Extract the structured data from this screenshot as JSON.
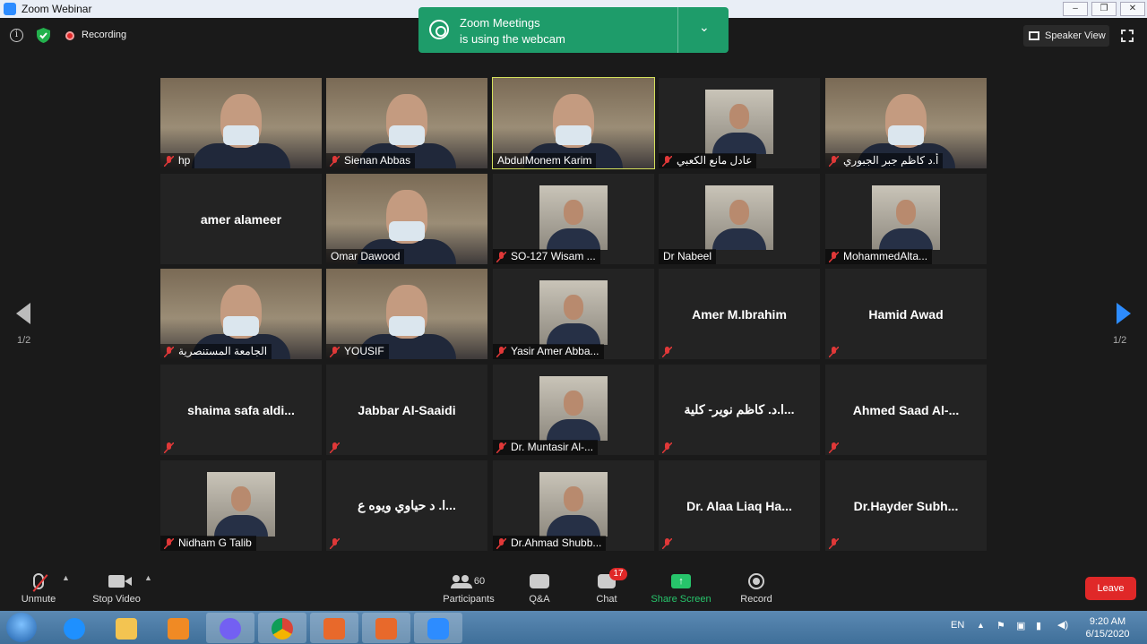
{
  "window": {
    "title": "Zoom Webinar",
    "controls": [
      "–",
      "❐",
      "✕"
    ]
  },
  "topbar": {
    "info_icon": "i",
    "recording_label": "Recording",
    "speaker_view_label": "Speaker View"
  },
  "toast": {
    "line1": "Zoom Meetings",
    "line2": "is using the webcam",
    "chevron": "⌄"
  },
  "grid": {
    "page_indicator_left": "1/2",
    "page_indicator_right": "1/2",
    "tiles": [
      {
        "name": "hp",
        "video": true,
        "muted": true
      },
      {
        "name": "Sienan Abbas",
        "video": true,
        "muted": true
      },
      {
        "name": "AbdulMonem Karim",
        "video": true,
        "muted": false,
        "active": true
      },
      {
        "name": "عادل مانع الكعبي",
        "video": true,
        "muted": true
      },
      {
        "name": "أ.د كاظم جبر الجبوري",
        "video": true,
        "muted": true
      },
      {
        "name": "amer alameer",
        "video": false,
        "muted": false
      },
      {
        "name": "Omar Dawood",
        "video": true,
        "muted": false
      },
      {
        "name": "SO-127 Wisam ...",
        "video": true,
        "muted": true
      },
      {
        "name": "Dr Nabeel",
        "video": true,
        "muted": false
      },
      {
        "name": "MohammedAlta...",
        "video": true,
        "muted": true
      },
      {
        "name": "الجامعة المستنصرية",
        "video": true,
        "muted": true
      },
      {
        "name": "YOUSIF",
        "video": true,
        "muted": true
      },
      {
        "name": "Yasir Amer Abba...",
        "video": true,
        "muted": true
      },
      {
        "name": "Amer M.Ibrahim",
        "video": false,
        "muted": true
      },
      {
        "name": "Hamid Awad",
        "video": false,
        "muted": true
      },
      {
        "name": "shaima safa aldi...",
        "video": false,
        "muted": true
      },
      {
        "name": "Jabbar Al-Saaidi",
        "video": false,
        "muted": true
      },
      {
        "name": "Dr. Muntasir Al-...",
        "video": true,
        "muted": true
      },
      {
        "name": "ا.د. كاظم نوير- كلية...",
        "video": false,
        "muted": true
      },
      {
        "name": "Ahmed Saad Al-...",
        "video": false,
        "muted": true
      },
      {
        "name": "Nidham G Talib",
        "video": true,
        "muted": true
      },
      {
        "name": "ا. د حياوي ويوه ع...",
        "video": false,
        "muted": true
      },
      {
        "name": "Dr.Ahmad Shubb...",
        "video": true,
        "muted": true
      },
      {
        "name": "Dr. Alaa Liaq Ha...",
        "video": false,
        "muted": true
      },
      {
        "name": "Dr.Hayder  Subh...",
        "video": false,
        "muted": true
      }
    ]
  },
  "toolbar": {
    "unmute": "Unmute",
    "stop_video": "Stop Video",
    "participants": "Participants",
    "participants_count": "60",
    "qa": "Q&A",
    "chat": "Chat",
    "chat_badge": "17",
    "share_screen": "Share Screen",
    "record": "Record",
    "leave": "Leave"
  },
  "taskbar": {
    "language": "EN",
    "time": "9:20 AM",
    "date": "6/15/2020",
    "apps": [
      "internet-explorer-icon",
      "file-explorer-icon",
      "media-player-icon",
      "viber-icon",
      "chrome-icon",
      "presentation-icon",
      "camera-app-icon",
      "zoom-icon"
    ]
  },
  "colors": {
    "toast_bg": "#1e9c6a",
    "leave_bg": "#e02828",
    "active_outline": "#d4e05b",
    "share_green": "#27c46b"
  }
}
